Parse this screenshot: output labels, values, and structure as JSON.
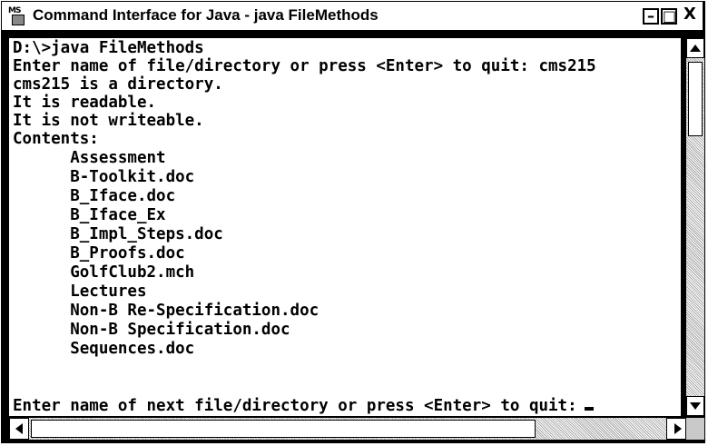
{
  "window": {
    "title": "Command Interface for Java - java FileMethods",
    "icon_label": "MS",
    "buttons": {
      "minimize": "–",
      "maximize": "□",
      "close": "X"
    }
  },
  "console": {
    "lines": [
      "D:\\>java FileMethods",
      "Enter name of file/directory or press <Enter> to quit: cms215",
      "cms215 is a directory.",
      "It is readable.",
      "It is not writeable.",
      "Contents:",
      "      Assessment",
      "      B-Toolkit.doc",
      "      B_Iface.doc",
      "      B_Iface_Ex",
      "      B_Impl_Steps.doc",
      "      B_Proofs.doc",
      "      GolfClub2.mch",
      "      Lectures",
      "      Non-B Re-Specification.doc",
      "      Non-B Specification.doc",
      "      Sequences.doc"
    ],
    "prompt": "Enter name of next file/directory or press <Enter> to quit:"
  },
  "icons": {
    "sys": "ms-dos-icon",
    "up": "scroll-up-arrow-icon",
    "down": "scroll-down-arrow-icon",
    "left": "scroll-left-arrow-icon",
    "right": "scroll-right-arrow-icon"
  }
}
